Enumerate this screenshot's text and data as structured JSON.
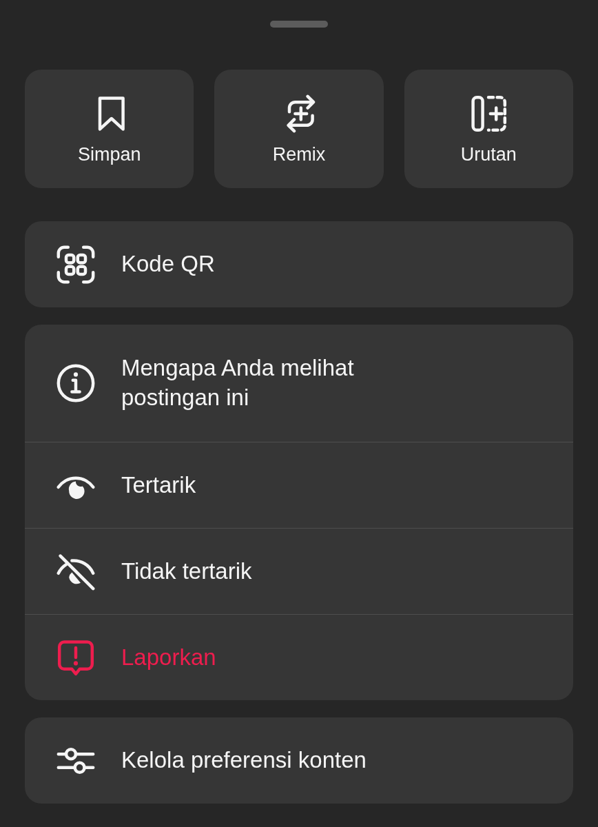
{
  "tiles": [
    {
      "label": "Simpan"
    },
    {
      "label": "Remix"
    },
    {
      "label": "Urutan"
    }
  ],
  "groups": [
    {
      "items": [
        {
          "label": "Kode QR",
          "kind": "normal"
        }
      ]
    },
    {
      "items": [
        {
          "label": "Mengapa Anda melihat postingan ini",
          "kind": "normal"
        },
        {
          "label": "Tertarik",
          "kind": "normal"
        },
        {
          "label": "Tidak tertarik",
          "kind": "normal"
        },
        {
          "label": "Laporkan",
          "kind": "danger"
        }
      ]
    },
    {
      "items": [
        {
          "label": "Kelola preferensi konten",
          "kind": "normal"
        }
      ]
    }
  ]
}
